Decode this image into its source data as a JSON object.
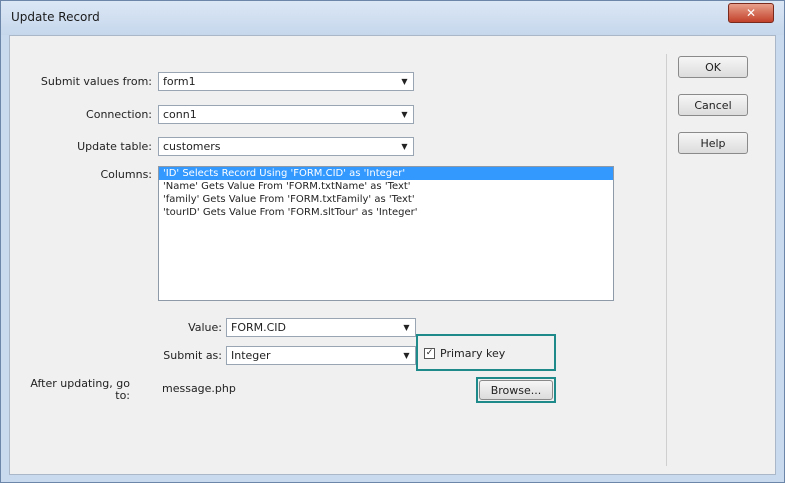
{
  "window": {
    "title": "Update Record",
    "close_glyph": "✕"
  },
  "form": {
    "submit_values_from": {
      "label": "Submit values from:",
      "value": "form1"
    },
    "connection": {
      "label": "Connection:",
      "value": "conn1"
    },
    "update_table": {
      "label": "Update table:",
      "value": "customers"
    },
    "columns": {
      "label": "Columns:",
      "items": [
        "'ID' Selects Record Using 'FORM.CID' as 'Integer'",
        "'Name' Gets Value From 'FORM.txtName' as 'Text'",
        "'family' Gets Value From 'FORM.txtFamily' as 'Text'",
        "'tourID' Gets Value From 'FORM.sltTour' as 'Integer'"
      ],
      "selected_index": 0
    },
    "value": {
      "label": "Value:",
      "value": "FORM.CID"
    },
    "submit_as": {
      "label": "Submit as:",
      "value": "Integer"
    },
    "primary_key": {
      "label": "Primary key",
      "checked": true,
      "check_glyph": "✓"
    },
    "after_updating": {
      "label": "After updating, go to:",
      "value": "message.php"
    },
    "browse_label": "Browse..."
  },
  "buttons": {
    "ok": "OK",
    "cancel": "Cancel",
    "help": "Help"
  },
  "icons": {
    "dropdown": "chevron-down-icon",
    "arrow_glyph": "▼"
  },
  "colors": {
    "selection": "#3399ff",
    "highlight": "#1f8a8a"
  }
}
